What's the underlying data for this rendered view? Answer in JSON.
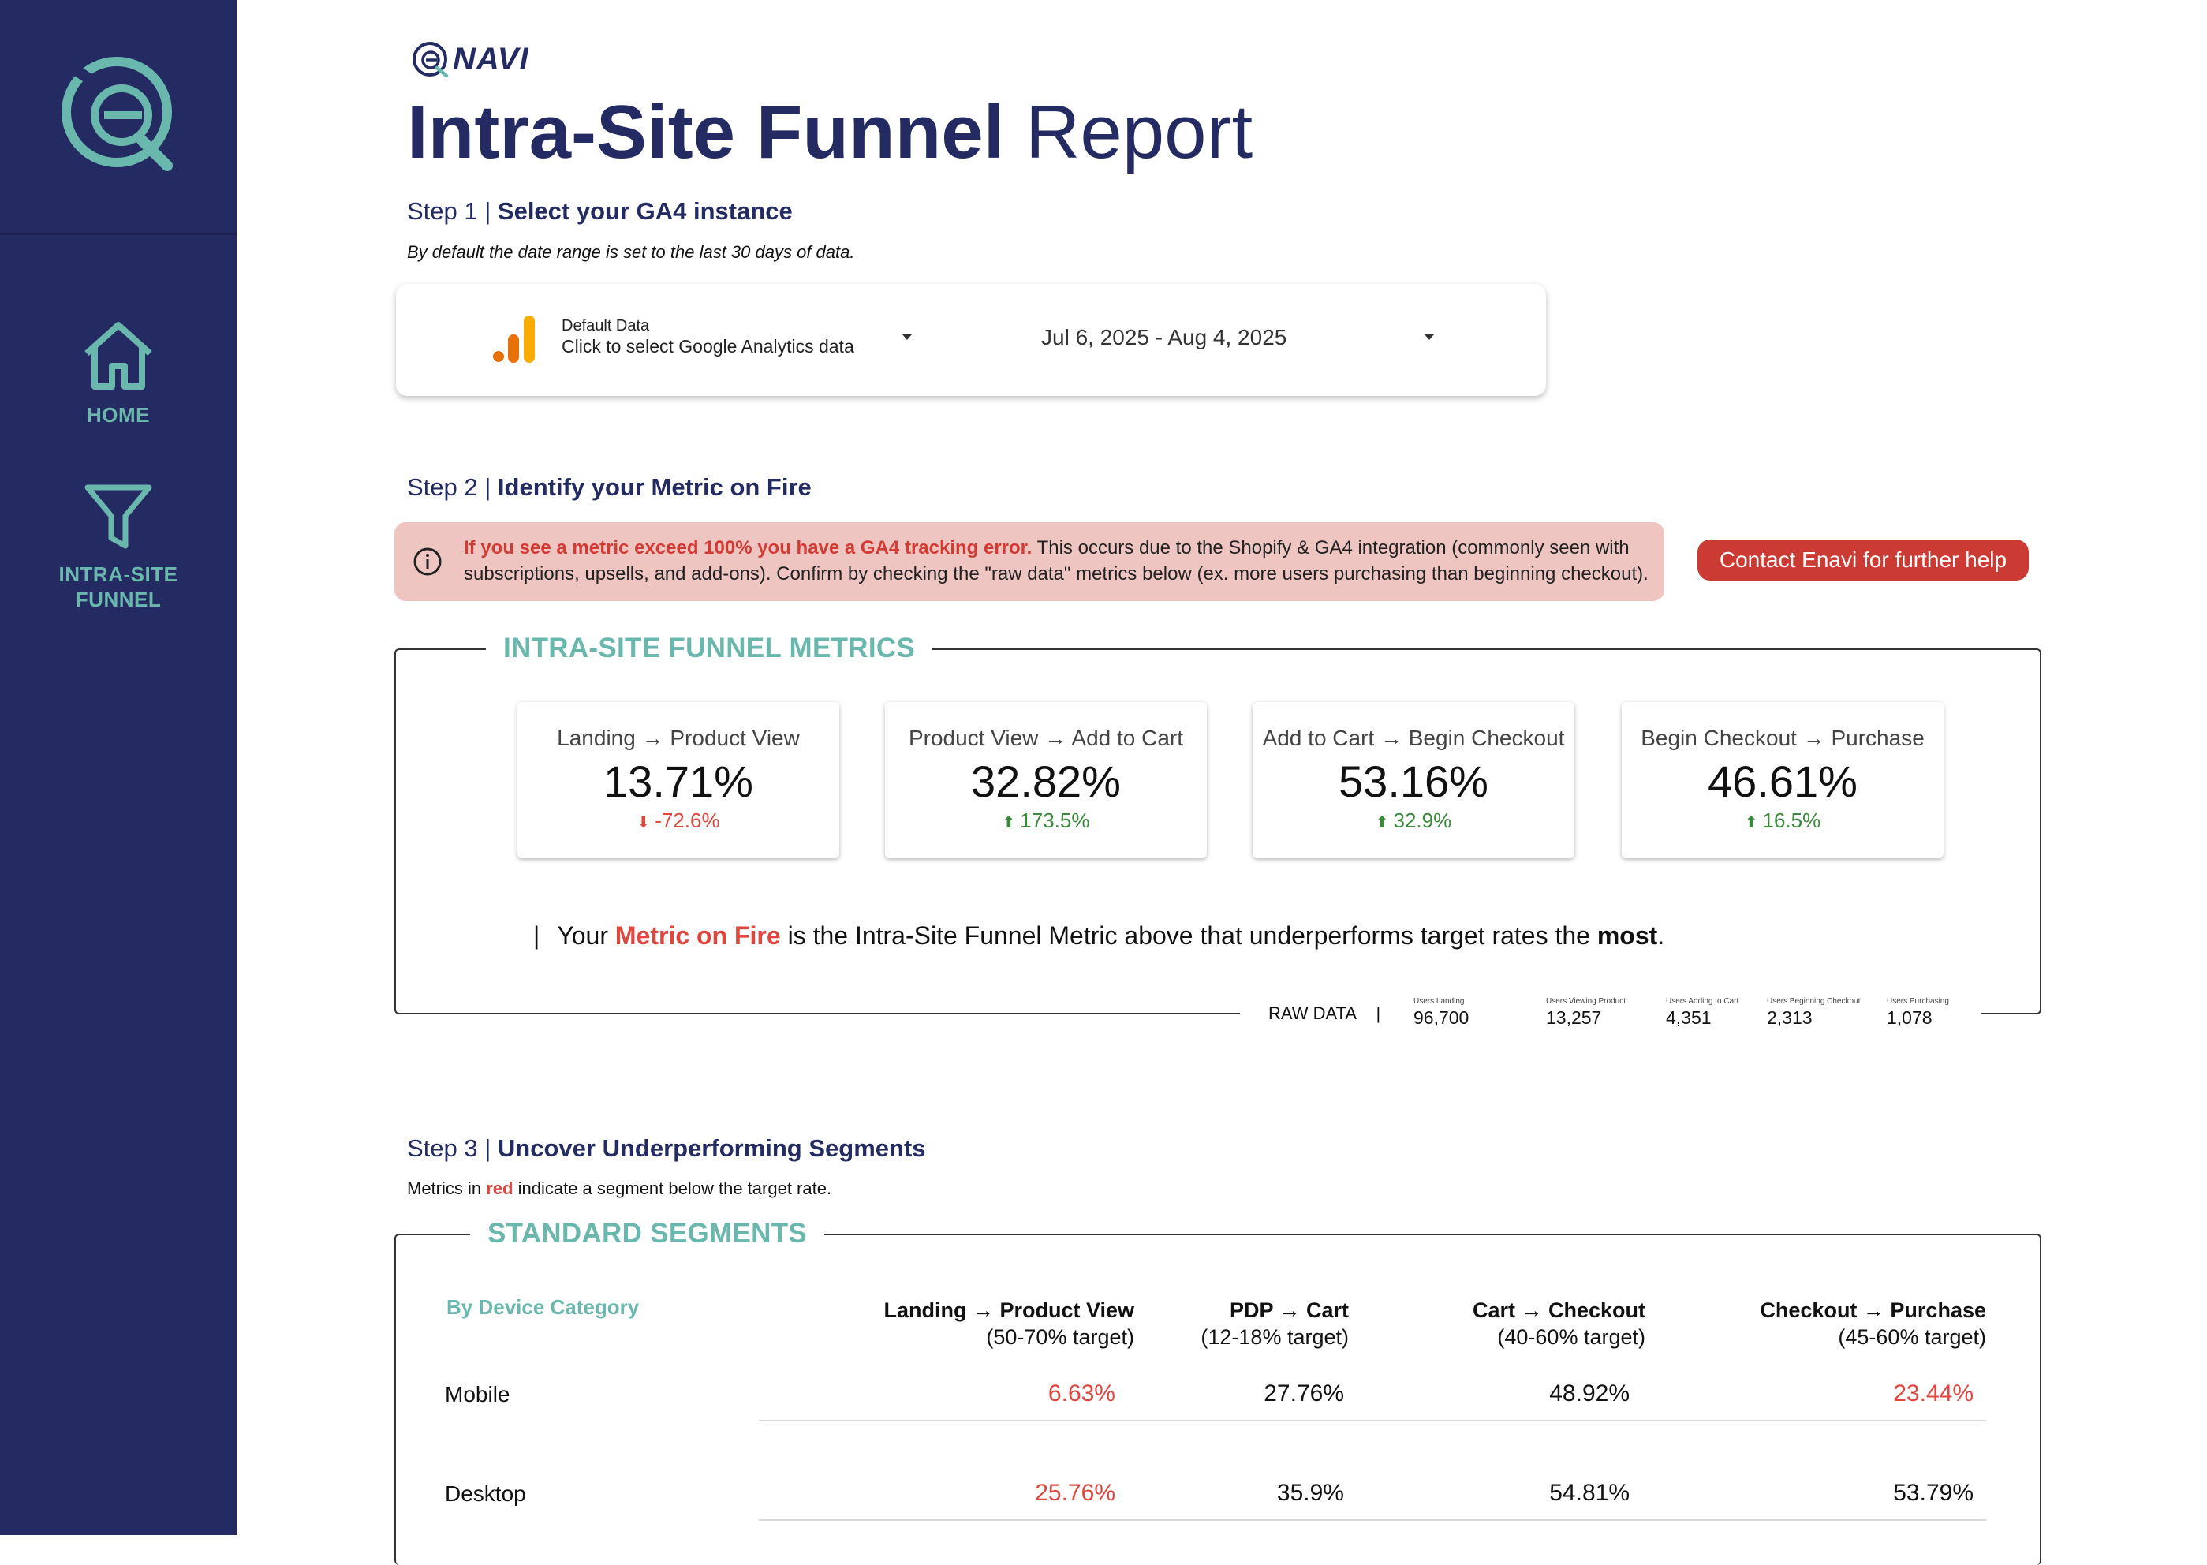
{
  "sidebar": {
    "logo_icon": "enavi-logo-icon",
    "items": [
      {
        "label": "HOME",
        "icon": "home-icon"
      },
      {
        "label": "INTRA-SITE FUNNEL",
        "label_line1": "INTRA-SITE",
        "label_line2": "FUNNEL",
        "icon": "funnel-icon"
      }
    ]
  },
  "brand": {
    "name": "NAVI"
  },
  "title": {
    "bold": "Intra-Site Funnel",
    "light": "Report"
  },
  "step1": {
    "prefix": "Step 1 | ",
    "heading": "Select your GA4 instance",
    "note": "By default the date range is set to the last 30 days of data."
  },
  "selector": {
    "source_small": "Default Data",
    "source_main": "Click to select Google Analytics data",
    "date_range": "Jul 6, 2025 - Aug 4, 2025"
  },
  "step2": {
    "prefix": "Step 2 | ",
    "heading": "Identify your Metric on Fire"
  },
  "alert": {
    "warning": "If you see a metric exceed 100% you have a GA4 tracking error.",
    "message": " This occurs due to the Shopify & GA4 integration (commonly seen with subscriptions, upsells, and add-ons). Confirm by checking the \"raw data\" metrics below (ex. more users purchasing than beginning checkout)."
  },
  "contact_button": "Contact Enavi for further help",
  "funnel_metrics": {
    "title": "INTRA-SITE FUNNEL METRICS",
    "kpis": [
      {
        "label": "Landing → Product View",
        "value": "13.71%",
        "delta": "-72.6%",
        "direction": "down"
      },
      {
        "label": "Product View → Add to Cart",
        "value": "32.82%",
        "delta": "173.5%",
        "direction": "up"
      },
      {
        "label": "Add to Cart → Begin Checkout",
        "value": "53.16%",
        "delta": "32.9%",
        "direction": "up"
      },
      {
        "label": "Begin Checkout → Purchase",
        "value": "46.61%",
        "delta": "16.5%",
        "direction": "up"
      }
    ],
    "fire_line": {
      "bar": "|",
      "pre": "Your ",
      "highlight": "Metric on Fire",
      "mid": " is the Intra-Site Funnel Metric above that underperforms target rates the ",
      "bold": "most",
      "post": "."
    },
    "raw_data": {
      "label": "RAW DATA",
      "separator": "|",
      "items": [
        {
          "label": "Users Landing",
          "value": "96,700"
        },
        {
          "label": "Users Viewing Product",
          "value": "13,257"
        },
        {
          "label": "Users Adding to Cart",
          "value": "4,351"
        },
        {
          "label": "Users Beginning Checkout",
          "value": "2,313"
        },
        {
          "label": "Users Purchasing",
          "value": "1,078"
        }
      ]
    }
  },
  "step3": {
    "prefix": "Step 3 | ",
    "heading": "Uncover Underperforming Segments",
    "note_pre": "Metrics in ",
    "note_red": "red",
    "note_post": " indicate a segment below the target rate."
  },
  "segments": {
    "title": "STANDARD SEGMENTS",
    "group_label": "By Device Category",
    "columns": [
      {
        "name": "Landing → Product View",
        "target": "(50-70% target)"
      },
      {
        "name": "PDP → Cart",
        "target": "(12-18% target)"
      },
      {
        "name": "Cart → Checkout",
        "target": "(40-60% target)"
      },
      {
        "name": "Checkout → Purchase",
        "target": "(45-60% target)"
      }
    ],
    "rows": [
      {
        "label": "Mobile",
        "values": [
          "6.63%",
          "27.76%",
          "48.92%",
          "23.44%"
        ],
        "below_target": [
          true,
          false,
          false,
          true
        ]
      },
      {
        "label": "Desktop",
        "values": [
          "25.76%",
          "35.9%",
          "54.81%",
          "53.79%"
        ],
        "below_target": [
          true,
          false,
          false,
          false
        ]
      }
    ]
  },
  "colors": {
    "sidebar": "#242b62",
    "teal": "#6ab8ad",
    "alert_bg": "#efc5c2",
    "red": "#e0463e",
    "green": "#3a8a3c"
  }
}
